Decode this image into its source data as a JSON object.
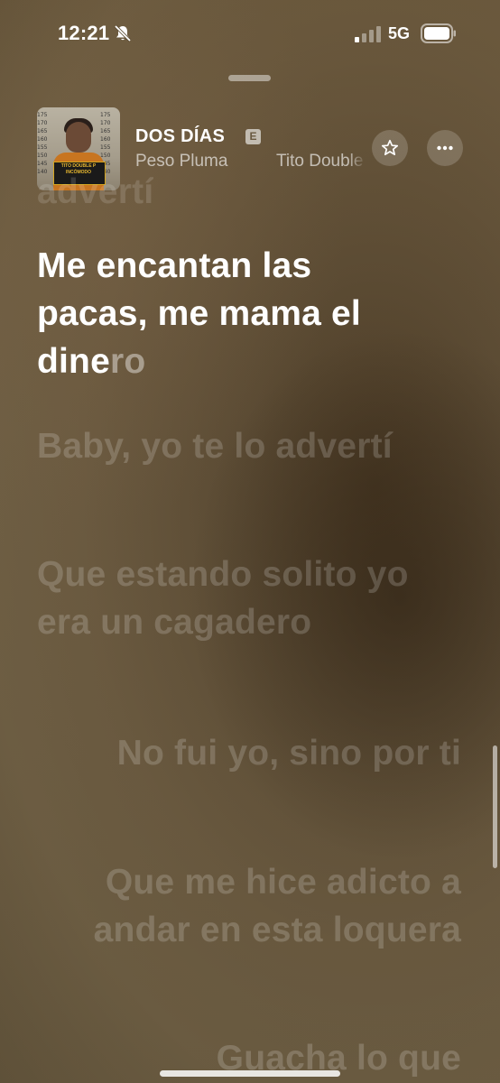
{
  "status_bar": {
    "time": "12:21",
    "network": "5G",
    "icons": [
      "bell-slash-icon",
      "signal-icon",
      "battery-icon"
    ]
  },
  "now_playing": {
    "title": "DOS DÍAS",
    "explicit_badge": "E",
    "artists": [
      "Peso Pluma",
      "Tito Double P"
    ],
    "album_art_text": "TITO DOUBLE P INCÓMODO"
  },
  "actions": {
    "star_icon": "star-icon",
    "more_icon": "ellipsis-icon"
  },
  "lyrics": {
    "previous_fragment": "advertí",
    "current_sung": "Me encantan las pacas, me mama el dine",
    "current_unsung": "ro",
    "lines": [
      {
        "text": "Baby, yo te lo advertí",
        "align": "left"
      },
      {
        "text": "Que estando solito yo era un cagadero",
        "align": "left"
      },
      {
        "text": "No fui yo, sino por ti",
        "align": "right"
      },
      {
        "text": "Que me hice adicto a andar en esta loquera",
        "align": "right"
      },
      {
        "text": "Guacha lo que",
        "align": "right"
      }
    ]
  },
  "colors": {
    "background": "#6b5a40",
    "active_lyric": "#ffffff",
    "inactive_lyric": "rgba(255,255,255,0.18)"
  }
}
